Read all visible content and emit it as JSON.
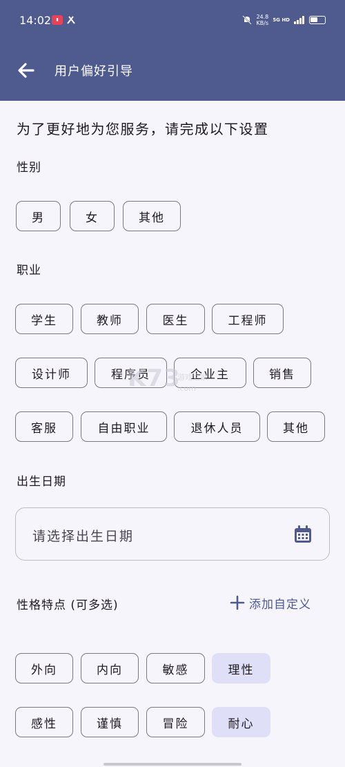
{
  "status_bar": {
    "time": "14:02",
    "speed_value": "24.8",
    "speed_unit": "KB/s",
    "network": "5G HD"
  },
  "header": {
    "title": "用户偏好引导",
    "back_icon": "arrow-left-icon",
    "background": "#4f5a8f"
  },
  "intro": "为了更好地为您服务，请完成以下设置",
  "gender": {
    "label": "性别",
    "options": [
      "男",
      "女",
      "其他"
    ]
  },
  "occupation": {
    "label": "职业",
    "options": [
      "学生",
      "教师",
      "医生",
      "工程师",
      "设计师",
      "程序员",
      "企业主",
      "销售",
      "客服",
      "自由职业",
      "退休人员",
      "其他"
    ]
  },
  "birthday": {
    "label": "出生日期",
    "placeholder": "请选择出生日期",
    "icon": "calendar-icon"
  },
  "personality": {
    "label": "性格特点 (可多选)",
    "add_custom": "添加自定义",
    "options": [
      "外向",
      "内向",
      "敏感",
      "理性",
      "感性",
      "谨慎",
      "冒险",
      "耐心"
    ],
    "selected": [
      "理性",
      "耐心"
    ],
    "selected_color": "#dfe0f7"
  },
  "watermark": {
    "main": "K73",
    "sub": "游戏之家",
    "domain": ".com"
  }
}
